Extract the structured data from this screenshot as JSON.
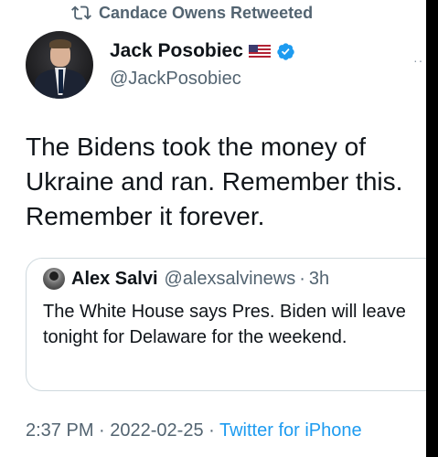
{
  "retweet": {
    "icon": "retweet-icon",
    "label": "Candace Owens Retweeted"
  },
  "author": {
    "name": "Jack Posobiec",
    "handle": "@JackPosobiec",
    "flag_icon": "us-flag-icon",
    "verified_icon": "verified-badge-icon"
  },
  "tweet": {
    "text": "The Bidens took the money of Ukraine and ran. Remember this. Remember it forever."
  },
  "quote": {
    "name": "Alex Salvi",
    "handle": "@alexsalvinews",
    "separator": "·",
    "time": "3h",
    "text": "The White House says Pres. Biden will leave tonight for Delaware for the weekend."
  },
  "meta": {
    "time": "2:37 PM",
    "sep1": " · ",
    "date": "2022-02-25",
    "sep2": " · ",
    "source": "Twitter for iPhone"
  },
  "colors": {
    "accent": "#1d9bf0",
    "secondary_text": "#536471",
    "primary_text": "#0f1419"
  }
}
